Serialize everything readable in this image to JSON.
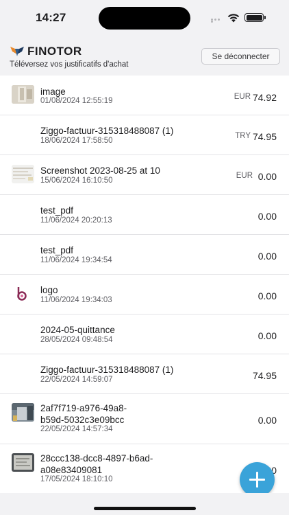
{
  "status_bar": {
    "time": "14:27"
  },
  "header": {
    "brand": "FINOTOR",
    "subtitle": "Téléversez vos justificatifs d'achat",
    "logout_label": "Se déconnecter"
  },
  "colors": {
    "accent": "#3aa3d9",
    "brand_orange": "#e8892b",
    "brand_navy": "#1f3a5f"
  },
  "receipts": [
    {
      "line1": "image",
      "line2": "",
      "date": "01/08/2024 12:55:19",
      "currency": "EUR",
      "amount": "74.92",
      "thumb": "photo-thumbnail"
    },
    {
      "line1": "Ziggo-factuur-315318488087 (1)",
      "line2": "",
      "date": "18/06/2024 17:58:50",
      "currency": "TRY",
      "amount": "74.95",
      "thumb": ""
    },
    {
      "line1": "Screenshot 2023-08-25 at 10",
      "line2": "",
      "date": "15/06/2024 16:10:50",
      "currency": "EUR",
      "amount": "0.00",
      "thumb": "screenshot-thumbnail"
    },
    {
      "line1": "test_pdf",
      "line2": "",
      "date": "11/06/2024 20:20:13",
      "currency": "",
      "amount": "0.00",
      "thumb": ""
    },
    {
      "line1": "test_pdf",
      "line2": "",
      "date": "11/06/2024 19:34:54",
      "currency": "",
      "amount": "0.00",
      "thumb": ""
    },
    {
      "line1": "logo",
      "line2": "",
      "date": "11/06/2024 19:34:03",
      "currency": "",
      "amount": "0.00",
      "thumb": "logo-thumbnail"
    },
    {
      "line1": "2024-05-quittance",
      "line2": "",
      "date": "28/05/2024 09:48:54",
      "currency": "",
      "amount": "0.00",
      "thumb": ""
    },
    {
      "line1": "Ziggo-factuur-315318488087 (1)",
      "line2": "",
      "date": "22/05/2024 14:59:07",
      "currency": "",
      "amount": "74.95",
      "thumb": ""
    },
    {
      "line1": "2af7f719-a976-49a8-",
      "line2": "b59d-5032c3e09bcc",
      "date": "22/05/2024 14:57:34",
      "currency": "",
      "amount": "0.00",
      "thumb": "photo-thumbnail"
    },
    {
      "line1": "28ccc138-dcc8-4897-b6ad-",
      "line2": "a08e83409081",
      "date": "17/05/2024 18:10:10",
      "currency": "",
      "amount": "0.00",
      "thumb": "document-thumbnail"
    }
  ],
  "fab": {
    "icon": "plus-icon"
  }
}
